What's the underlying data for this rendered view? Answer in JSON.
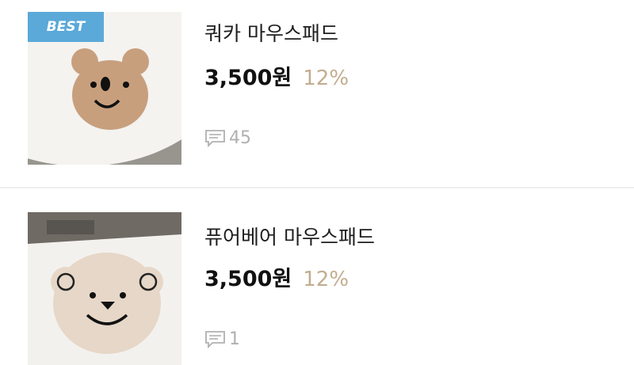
{
  "products": [
    {
      "name": "쿼카 마우스패드",
      "price": "3,500원",
      "discount": "12%",
      "badge": "BEST",
      "review_count": "45",
      "icon": "comment-icon"
    },
    {
      "name": "퓨어베어 마우스패드",
      "price": "3,500원",
      "discount": "12%",
      "review_count": "1",
      "icon": "comment-icon"
    }
  ],
  "colors": {
    "badge": "#5aa9d8",
    "discount": "#c3ad8f",
    "review": "#b0b0b0"
  }
}
